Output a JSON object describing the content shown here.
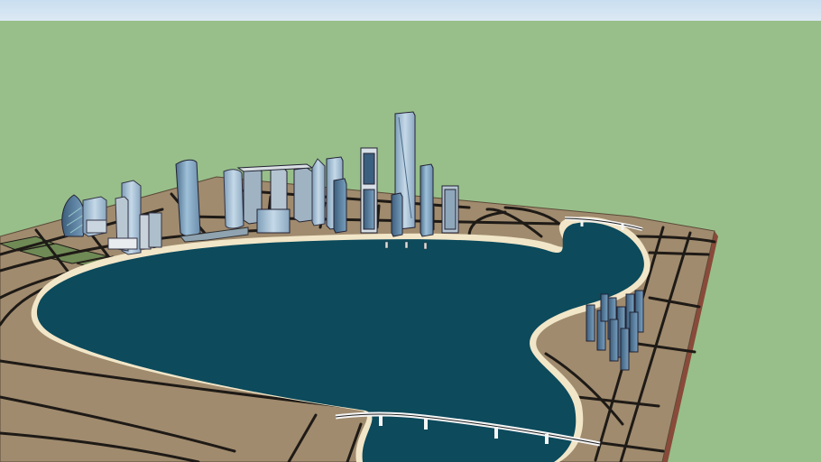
{
  "scene": {
    "subject": "3d-city-model",
    "colors": {
      "sky_top": "#c9def0",
      "sky_bottom": "#d9e8f3",
      "grass": "#98bf8a",
      "ground": "#a08b6e",
      "ground_side": "#8a4a3a",
      "road": "#1e1a16",
      "water": "#0c4a5c",
      "shore": "#f2e6c8",
      "park": "#6f8a55",
      "tower_glass": "#8fb0c8",
      "tower_glass_dark": "#5a7a96",
      "bridge": "#f5f5f5"
    }
  }
}
